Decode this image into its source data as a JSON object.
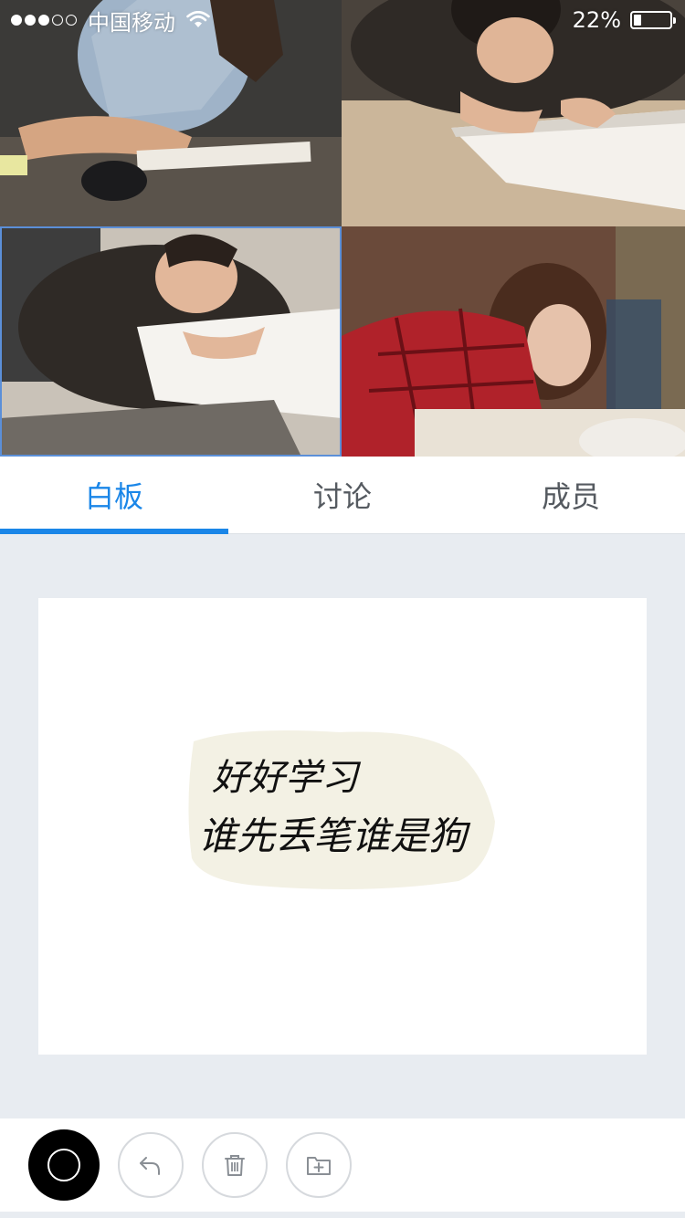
{
  "status_bar": {
    "carrier": "中国移动",
    "signal_bars_filled": 3,
    "signal_bars_total": 5,
    "battery_percent_text": "22%",
    "battery_level": 0.22
  },
  "videos": [
    {
      "name": "participant-1",
      "shirt_color": "#9fb3c8",
      "bg_color": "#3d3d3d"
    },
    {
      "name": "participant-2",
      "shirt_color": "#2f2a26",
      "bg_color": "#cbb69a"
    },
    {
      "name": "participant-3",
      "shirt_color": "#2f2a26",
      "bg_color": "#c9c2b8"
    },
    {
      "name": "participant-4",
      "shirt_color": "#b0222a",
      "bg_color": "#6a4a3a"
    }
  ],
  "tabs": [
    {
      "label": "白板",
      "active": true
    },
    {
      "label": "讨论",
      "active": false
    },
    {
      "label": "成员",
      "active": false
    }
  ],
  "whiteboard": {
    "handwriting_line_1": "好好学习",
    "handwriting_line_2": "谁先丢笔谁是狗"
  },
  "toolbar": {
    "pen_color": "#000000",
    "tools": [
      "undo-icon",
      "trash-icon",
      "add-page-icon"
    ]
  },
  "colors": {
    "accent": "#1a86e8",
    "background": "#e8ecf1",
    "tab_text": "#555a60"
  }
}
